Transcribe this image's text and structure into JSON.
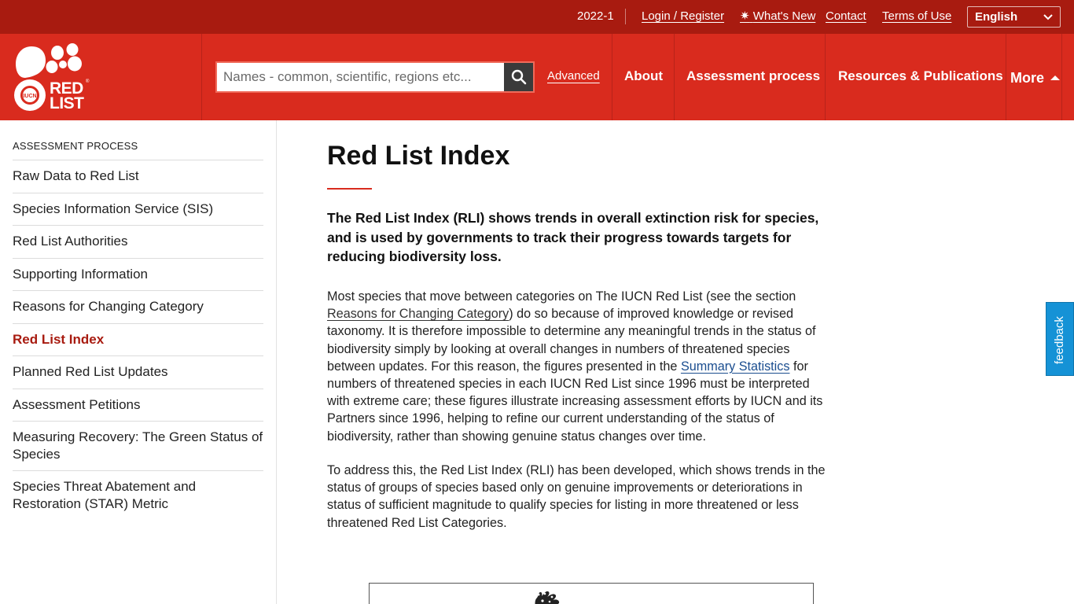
{
  "topbar": {
    "version": "2022-1",
    "login": "Login / Register",
    "whats_new": "What's New",
    "contact": "Contact",
    "terms": "Terms of Use",
    "language": "English"
  },
  "header": {
    "logo_text": "RED LIST",
    "logo_badge": "IUCN",
    "search_placeholder": "Names - common, scientific, regions etc...",
    "advanced": "Advanced",
    "nav": [
      "About",
      "Assessment process",
      "Resources & Publications",
      "More"
    ]
  },
  "sidebar": {
    "heading": "ASSESSMENT PROCESS",
    "items": [
      {
        "label": "Raw Data to Red List"
      },
      {
        "label": "Species Information Service (SIS)"
      },
      {
        "label": "Red List Authorities"
      },
      {
        "label": "Supporting Information"
      },
      {
        "label": "Reasons for Changing Category"
      },
      {
        "label": "Red List Index"
      },
      {
        "label": "Planned Red List Updates"
      },
      {
        "label": "Assessment Petitions"
      },
      {
        "label": "Measuring Recovery: The Green Status of Species"
      },
      {
        "label": "Species Threat Abatement and Restoration (STAR) Metric"
      }
    ],
    "active_index": 5
  },
  "main": {
    "title": "Red List Index",
    "lead": "The Red List Index (RLI) shows trends in overall extinction risk for species, and is used by governments to track their progress towards targets for reducing biodiversity loss.",
    "p1": {
      "t1": "Most species that move between categories on The IUCN Red List (see the section ",
      "link1": "Reasons for Changing Category",
      "t2": ") do so because of improved knowledge or revised taxonomy. It is therefore impossible to determine any meaningful trends in the status of biodiversity simply by looking at overall changes in numbers of threatened species between updates. For this reason, the figures presented in the ",
      "link2": "Summary Statistics",
      "t3": " for numbers of threatened species in each IUCN Red List since 1996 must be interpreted with extreme care; these figures illustrate increasing assessment efforts by IUCN and its Partners since 1996, helping to refine our current understanding of the status of biodiversity, rather than showing genuine status changes over time."
    },
    "p2": "To address this, the Red List Index (RLI) has been developed, which shows trends in the status of groups of species based only on genuine improvements or deteriorations in status of sufficient magnitude to qualify species for listing in more threatened or less threatened Red List Categories."
  },
  "feedback": "feedback",
  "colors": {
    "topbar": "#a81b10",
    "header": "#d92b1e",
    "accent": "#a81b10",
    "feedback": "#1592d6"
  }
}
